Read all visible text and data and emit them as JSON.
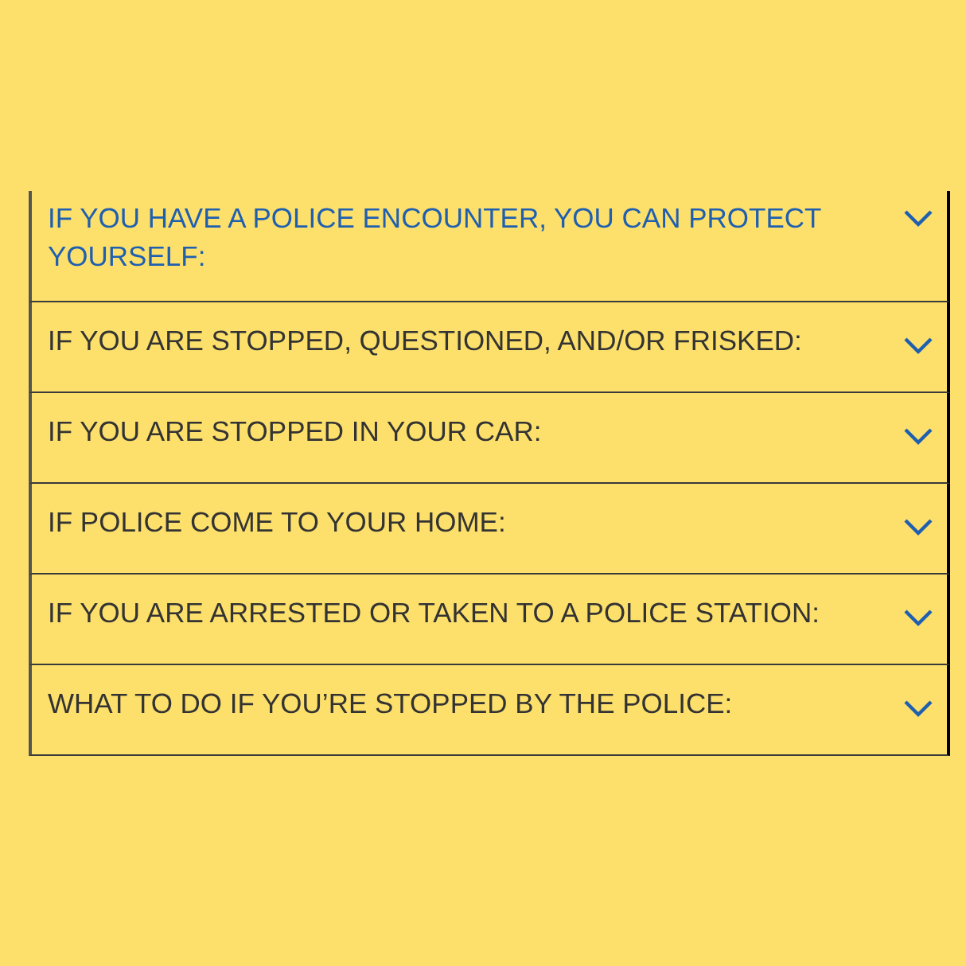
{
  "accordion": [
    {
      "label": "IF YOU HAVE A POLICE ENCOUNTER, YOU CAN PROTECT YOURSELF:",
      "selected": true
    },
    {
      "label": "IF YOU ARE STOPPED, QUESTIONED, AND/OR FRISKED:",
      "selected": false
    },
    {
      "label": "IF YOU ARE STOPPED IN YOUR CAR:",
      "selected": false
    },
    {
      "label": "IF POLICE COME TO YOUR HOME:",
      "selected": false
    },
    {
      "label": "IF YOU ARE ARRESTED OR TAKEN TO A POLICE STATION:",
      "selected": false
    },
    {
      "label": "WHAT TO DO IF YOU’RE STOPPED BY THE POLICE:",
      "selected": false
    }
  ]
}
